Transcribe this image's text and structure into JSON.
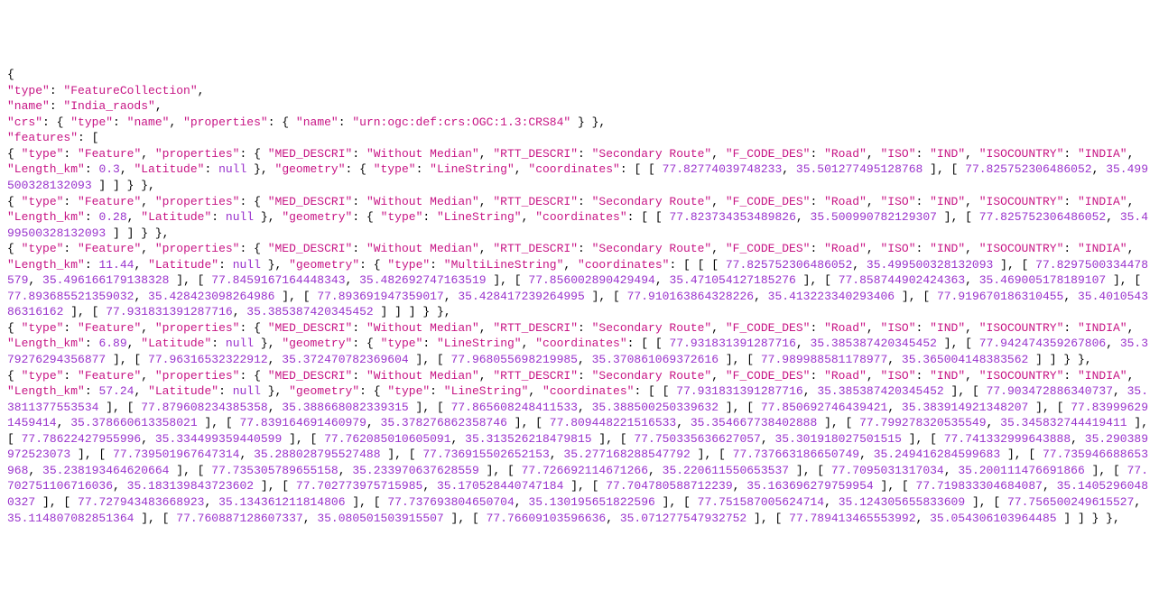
{
  "header": {
    "type_key": "\"type\"",
    "type_val": "\"FeatureCollection\"",
    "name_key": "\"name\"",
    "name_val": "\"India_raods\"",
    "crs_key": "\"crs\"",
    "crs_type_key": "\"type\"",
    "crs_type_val": "\"name\"",
    "crs_props_key": "\"properties\"",
    "crs_propname_key": "\"name\"",
    "crs_propname_val": "\"urn:ogc:def:crs:OGC:1.3:CRS84\"",
    "features_key": "\"features\""
  },
  "prop_keys": {
    "type": "\"type\"",
    "feature": "\"Feature\"",
    "properties": "\"properties\"",
    "med": "\"MED_DESCRI\"",
    "med_val": "\"Without Median\"",
    "rtt": "\"RTT_DESCRI\"",
    "rtt_val": "\"Secondary Route\"",
    "fcode": "\"F_CODE_DES\"",
    "fcode_val": "\"Road\"",
    "iso": "\"ISO\"",
    "iso_val": "\"IND\"",
    "isoc": "\"ISOCOUNTRY\"",
    "isoc_val": "\"INDIA\"",
    "len": "\"Length_km\"",
    "lat": "\"Latitude\"",
    "null": "null",
    "geometry": "\"geometry\"",
    "linestring": "\"LineString\"",
    "multilinestring": "\"MultiLineString\"",
    "coordinates": "\"coordinates\""
  },
  "features": [
    {
      "len": "0.3",
      "geom": "\"LineString\"",
      "coords_open": "[ [ ",
      "coords": [
        [
          "77.82774039748233",
          "35.501277495128768"
        ],
        [
          "77.825752306486052",
          "35.499500328132093"
        ]
      ]
    },
    {
      "len": "0.28",
      "geom": "\"LineString\"",
      "coords_open": "[ [ ",
      "coords": [
        [
          "77.823734353489826",
          "35.500990782129307"
        ],
        [
          "77.825752306486052",
          "35.499500328132093"
        ]
      ]
    },
    {
      "len": "11.44",
      "geom": "\"MultiLineString\"",
      "coords_open": "[ [ [ ",
      "coords": [
        [
          "77.825752306486052",
          "35.499500328132093"
        ],
        [
          "77.8297500334478579",
          "35.496166179138328"
        ],
        [
          "77.8459167164448343",
          "35.482692747163519"
        ],
        [
          "77.856002890429494",
          "35.471054127185276"
        ],
        [
          "77.858744902424363",
          "35.469005178189107"
        ],
        [
          "77.893685521359032",
          "35.428423098264986"
        ],
        [
          "77.893691947359017",
          "35.428417239264995"
        ],
        [
          "77.910163864328226",
          "35.413223340293406"
        ],
        [
          "77.919670186310455",
          "35.401054386316162"
        ],
        [
          "77.931831391287716",
          "35.385387420345452"
        ]
      ],
      "close_extra": " ]"
    },
    {
      "len": "6.89",
      "geom": "\"LineString\"",
      "coords_open": "[ [ ",
      "coords": [
        [
          "77.931831391287716",
          "35.385387420345452"
        ],
        [
          "77.942474359267806",
          "35.379276294356877"
        ],
        [
          "77.96316532322912",
          "35.372470782369604"
        ],
        [
          "77.968055698219985",
          "35.370861069372616"
        ],
        [
          "77.989988581178977",
          "35.36500414838356​2"
        ]
      ]
    },
    {
      "len": "57.24",
      "geom": "\"LineString\"",
      "coords_open": "[ [ ",
      "coords": [
        [
          "77.931831391287716",
          "35.385387420345452"
        ],
        [
          "77.903472886340737",
          "35.3811377553534"
        ],
        [
          "77.879608234385358",
          "35.388668082339315"
        ],
        [
          "77.865608248411533",
          "35.388500250339632"
        ],
        [
          "77.850692746439421",
          "35.383914921348207"
        ],
        [
          "77.839996291459414",
          "35.378660613358021"
        ],
        [
          "77.839164691460979",
          "35.378276862358746"
        ],
        [
          "77.809448221516533",
          "35.354667738402888"
        ],
        [
          "77.799278320535549",
          "35.345832744419411"
        ],
        [
          "77.78622427955996",
          "35.334499359440599"
        ],
        [
          "77.762085010605091",
          "35.313526218479815"
        ],
        [
          "77.750335636627057",
          "35.301918027501515"
        ],
        [
          "77.741332999643888",
          "35.290389972523073"
        ],
        [
          "77.739501967647314",
          "35.288028795527488"
        ],
        [
          "77.736915502652153",
          "35.277168288547792"
        ],
        [
          "77.737663186650749",
          "35.249416284599683"
        ],
        [
          "77.735946688653968",
          "35.238193464620664"
        ],
        [
          "77.735305789655158",
          "35.233970637628559"
        ],
        [
          "77.726692114671266",
          "35.220611550653537"
        ],
        [
          "77.7095031317034",
          "35.200111476691866"
        ],
        [
          "77.702751106716036",
          "35.183139843723602"
        ],
        [
          "77.702773975715985",
          "35.170528440747184"
        ],
        [
          "77.704780588712239",
          "35.163696279759954"
        ],
        [
          "77.719833304684087",
          "35.14052960480327"
        ],
        [
          "77.7279434836​68923",
          "35.134361211814806"
        ],
        [
          "77.737693804650704",
          "35.130195651822596"
        ],
        [
          "77.751587005624714",
          "35.124305655833609"
        ],
        [
          "77.756500249615527",
          "35.114807082851364"
        ],
        [
          "77.760887128607337",
          "35.080501503915507"
        ],
        [
          "77.766091035​96636",
          "35.071277547932752"
        ],
        [
          "77.789413465553992",
          "35.054306103964485"
        ]
      ]
    }
  ]
}
